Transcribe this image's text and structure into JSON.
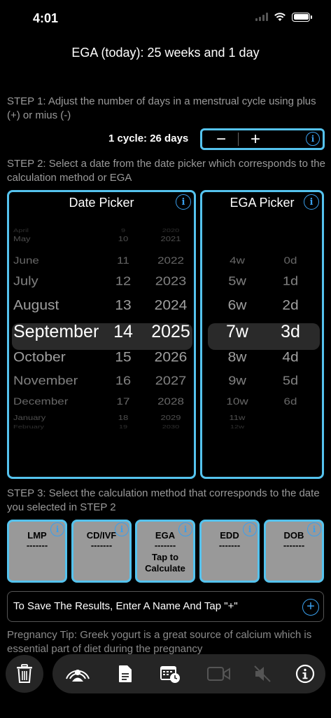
{
  "status": {
    "time": "4:01"
  },
  "header": {
    "title": "EGA (today): 25 weeks and 1 day"
  },
  "step1": {
    "text": "STEP 1: Adjust the number of days in a menstrual cycle using plus (+) or mius (-)"
  },
  "cycle": {
    "label": "1 cycle: 26 days",
    "minus": "−",
    "plus": "+"
  },
  "step2": {
    "text": "STEP 2: Select a date from the date picker which corresponds to the calculation method or EGA"
  },
  "date_picker": {
    "title": "Date Picker",
    "months": [
      "April",
      "May",
      "June",
      "July",
      "August",
      "September",
      "October",
      "November",
      "December",
      "January",
      "February"
    ],
    "days": [
      "9",
      "10",
      "11",
      "12",
      "13",
      "14",
      "15",
      "16",
      "17",
      "18",
      "19"
    ],
    "years": [
      "2020",
      "2021",
      "2022",
      "2023",
      "2024",
      "2025",
      "2026",
      "2027",
      "2028",
      "2029",
      "2030"
    ],
    "selected": {
      "month": "September",
      "day": "14",
      "year": "2025"
    }
  },
  "ega_picker": {
    "title": "EGA Picker",
    "weeks": [
      "4w",
      "5w",
      "6w",
      "7w",
      "8w",
      "9w",
      "10w",
      "11w",
      "12w"
    ],
    "days": [
      "0d",
      "1d",
      "2d",
      "3d",
      "4d",
      "5d",
      "6d"
    ],
    "selected": {
      "weeks": "7w",
      "days": "3d"
    }
  },
  "step3": {
    "text": "STEP 3: Select the calculation method that corresponds to the date you selected in STEP 2"
  },
  "methods": [
    {
      "label": "LMP",
      "value": "-------",
      "extra": ""
    },
    {
      "label": "CD/IVF",
      "value": "-------",
      "extra": ""
    },
    {
      "label": "EGA",
      "value": "-------",
      "extra": "Tap to Calculate"
    },
    {
      "label": "EDD",
      "value": "-------",
      "extra": ""
    },
    {
      "label": "DOB",
      "value": "-------",
      "extra": ""
    }
  ],
  "save": {
    "placeholder": "To Save The Results, Enter A Name And Tap \"+\"",
    "add": "+"
  },
  "tip": {
    "text": "Pregnancy Tip: Greek yogurt is a great source of calcium which is essential part of diet during the pregnancy"
  },
  "info_glyph": "i",
  "toolbar_icons": [
    "trash-icon",
    "share-person-icon",
    "document-icon",
    "calendar-clock-icon",
    "video-icon",
    "mute-icon",
    "info-icon"
  ],
  "colors": {
    "accent": "#55c3ee",
    "link": "#3aa0ee",
    "tile": "#999999"
  }
}
